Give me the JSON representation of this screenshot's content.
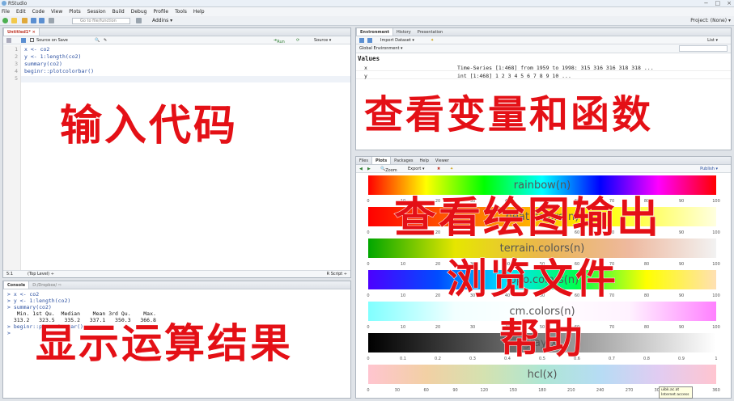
{
  "window": {
    "title": "RStudio",
    "controls": [
      "−",
      "□",
      "×"
    ]
  },
  "menu": [
    "File",
    "Edit",
    "Code",
    "View",
    "Plots",
    "Session",
    "Build",
    "Debug",
    "Profile",
    "Tools",
    "Help"
  ],
  "toolbar": {
    "goto_placeholder": "Go to file/function",
    "addins_label": "Addins ▾",
    "project_label": "Project: (None) ▾"
  },
  "editor": {
    "tab_label": "Untitled1* ×",
    "source_on_save": "Source on Save",
    "run_label": "Run",
    "source_label": "Source ▾",
    "lines": [
      {
        "no": "1",
        "text": "x <- co2"
      },
      {
        "no": "2",
        "text": "y <- 1:length(co2)"
      },
      {
        "no": "3",
        "text": "summary(co2)"
      },
      {
        "no": "4",
        "text": "beginr::plotcolorbar()"
      },
      {
        "no": "5",
        "text": ""
      }
    ],
    "status_pos": "5:1",
    "status_scope": "(Top Level) ÷",
    "status_type": "R Script ÷"
  },
  "console": {
    "tab_label": "Console",
    "path": "D:/Dropbox/ ⇨",
    "lines": [
      {
        "kind": "prompt",
        "text": "> x <- co2"
      },
      {
        "kind": "prompt",
        "text": "> y <- 1:length(co2)"
      },
      {
        "kind": "prompt",
        "text": "> summary(co2)"
      },
      {
        "kind": "out",
        "text": "   Min. 1st Qu.  Median    Mean 3rd Qu.    Max."
      },
      {
        "kind": "out",
        "text": "  313.2   323.5   335.2   337.1   350.3   366.8"
      },
      {
        "kind": "prompt",
        "text": "> beginr::plotcolorbar()"
      },
      {
        "kind": "prompt",
        "text": ">"
      }
    ]
  },
  "environment": {
    "tabs": [
      "Environment",
      "History",
      "Presentation"
    ],
    "import_label": "Import Dataset ▾",
    "scope_label": "Global Environment ▾",
    "list_label": "List ▾",
    "section": "Values",
    "rows": [
      {
        "name": "x",
        "value": "Time-Series [1:468] from 1959 to 1998: 315 316 316 318 318 ..."
      },
      {
        "name": "y",
        "value": "int [1:468] 1 2 3 4 5 6 7 8 9 10 ..."
      }
    ]
  },
  "files": {
    "tabs": [
      "Files",
      "Plots",
      "Packages",
      "Help",
      "Viewer"
    ],
    "zoom_label": "Zoom",
    "export_label": "Export ▾",
    "publish_label": "Publish ▾"
  },
  "plot": {
    "bars": [
      {
        "name": "rainbow",
        "label": "rainbow(n)",
        "gradient": [
          "#ff0000",
          "#ffff00",
          "#00ff00",
          "#00ffff",
          "#0000ff",
          "#ff00ff",
          "#ff0000"
        ]
      },
      {
        "name": "heat",
        "label": "heat.colors(n)",
        "gradient": [
          "#ff0000",
          "#ff8000",
          "#ffff00",
          "#ffffe0"
        ]
      },
      {
        "name": "terrain",
        "label": "terrain.colors(n)",
        "gradient": [
          "#00a600",
          "#e6e600",
          "#eab64e",
          "#eeb99f",
          "#f2f2f2"
        ]
      },
      {
        "name": "topo",
        "label": "topo.colors(n)",
        "gradient": [
          "#4c00ff",
          "#004cff",
          "#00e5ff",
          "#00ff4d",
          "#ffff00",
          "#ffe0b3"
        ]
      },
      {
        "name": "cm",
        "label": "cm.colors(n)",
        "gradient": [
          "#80ffff",
          "#f2ffff",
          "#ffffff",
          "#fff2ff",
          "#ff80ff"
        ]
      },
      {
        "name": "gray",
        "label": "gray(x)",
        "gradient": [
          "#000000",
          "#ffffff"
        ]
      },
      {
        "name": "hcl",
        "label": "hcl(x)",
        "gradient": [
          "#ffc5d0",
          "#f2d0a4",
          "#d4e2b0",
          "#aee6d4",
          "#b6dcf4",
          "#e1ccf2",
          "#ffc5d0"
        ]
      }
    ],
    "axes": [
      {
        "ticks": [
          "0",
          "10",
          "20",
          "30",
          "40",
          "50",
          "60",
          "70",
          "80",
          "90",
          "100"
        ]
      },
      {
        "ticks": [
          "0",
          "10",
          "20",
          "30",
          "40",
          "50",
          "60",
          "70",
          "80",
          "90",
          "100"
        ]
      },
      {
        "ticks": [
          "0",
          "10",
          "20",
          "30",
          "40",
          "50",
          "60",
          "70",
          "80",
          "90",
          "100"
        ]
      },
      {
        "ticks": [
          "0",
          "10",
          "20",
          "30",
          "40",
          "50",
          "60",
          "70",
          "80",
          "90",
          "100"
        ]
      },
      {
        "ticks": [
          "0",
          "10",
          "20",
          "30",
          "40",
          "50",
          "60",
          "70",
          "80",
          "90",
          "100"
        ]
      },
      {
        "ticks": [
          "0",
          "0.1",
          "0.2",
          "0.3",
          "0.4",
          "0.5",
          "0.6",
          "0.7",
          "0.8",
          "0.9",
          "1"
        ]
      },
      {
        "ticks": [
          "0",
          "30",
          "60",
          "90",
          "120",
          "150",
          "180",
          "210",
          "240",
          "270",
          "300",
          "330",
          "360"
        ]
      }
    ]
  },
  "overlays": {
    "code": "输入代码",
    "env": "查看变量和函数",
    "plots": "查看绘图输出",
    "files": "浏览文件",
    "help": "帮助",
    "console": "显示运算结果"
  },
  "tooltip": {
    "line1": "uibk.ac.at",
    "line2": "Internet access"
  }
}
